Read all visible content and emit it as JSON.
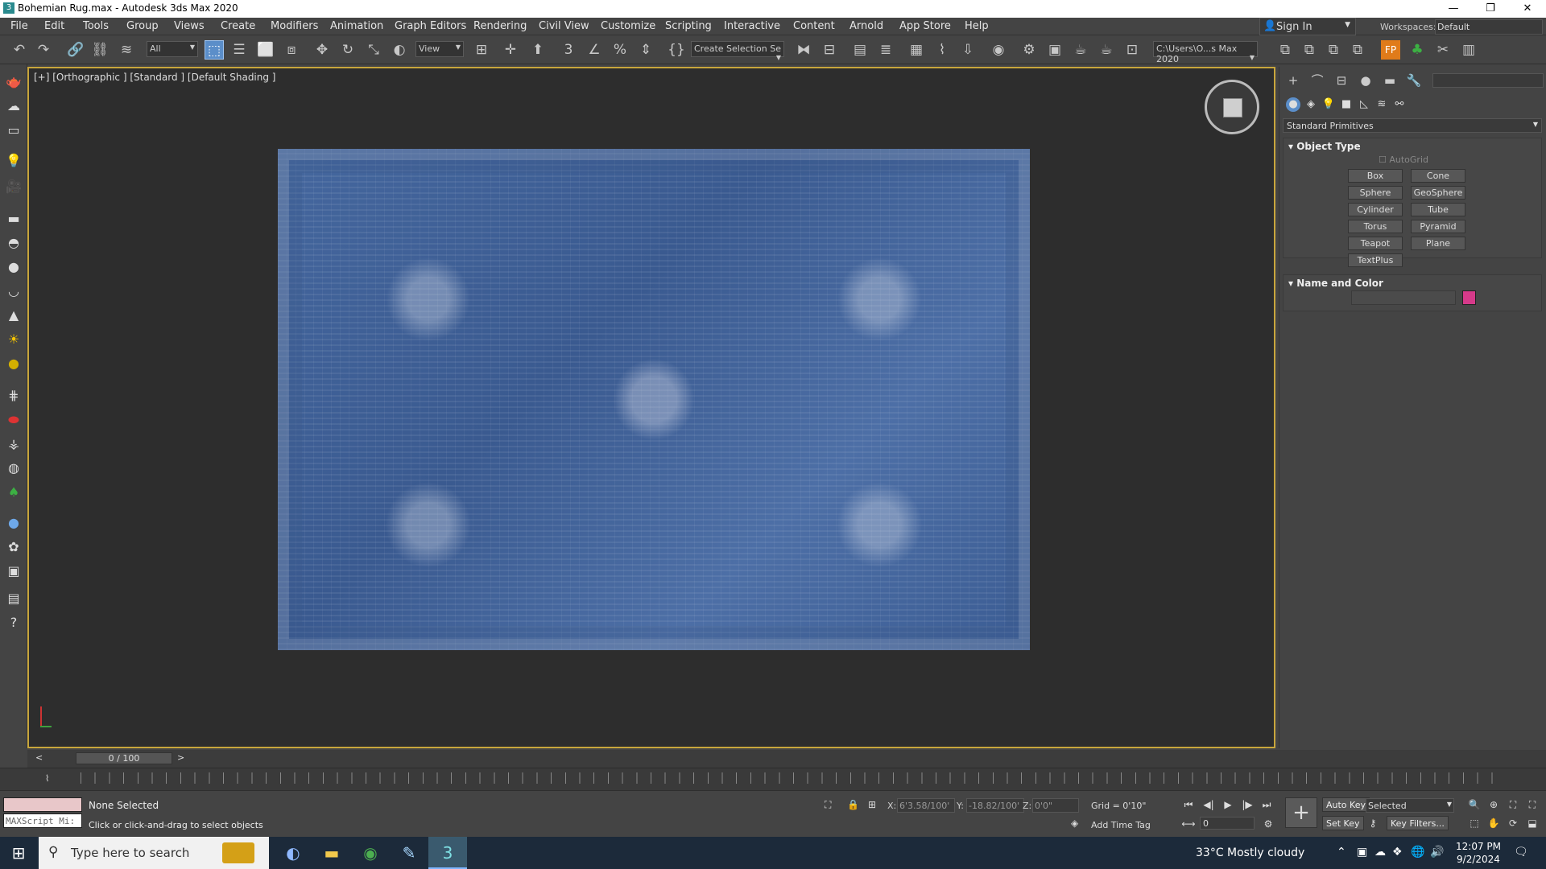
{
  "window": {
    "title": "Bohemian Rug.max - Autodesk 3ds Max 2020",
    "minimize": "—",
    "maximize": "❐",
    "close": "✕"
  },
  "menu": [
    "File",
    "Edit",
    "Tools",
    "Group",
    "Views",
    "Create",
    "Modifiers",
    "Animation",
    "Graph Editors",
    "Rendering",
    "Civil View",
    "Customize",
    "Scripting",
    "Interactive",
    "Content",
    "Arnold",
    "App Store",
    "Help"
  ],
  "signin": {
    "label": "Sign In"
  },
  "workspaces": {
    "label": "Workspaces:",
    "value": "Default"
  },
  "toolbar": {
    "selection_filter": "All",
    "ref_coord": "View",
    "named_selection": "Create Selection Se",
    "project_path": "C:\\Users\\O...s Max 2020"
  },
  "viewport": {
    "label": "[+] [Orthographic ] [Standard ] [Default Shading ]"
  },
  "command_panel": {
    "category": "Standard Primitives",
    "object_type": {
      "title": "Object Type",
      "autogrid": "AutoGrid",
      "buttons": [
        "Box",
        "Cone",
        "Sphere",
        "GeoSphere",
        "Cylinder",
        "Tube",
        "Torus",
        "Pyramid",
        "Teapot",
        "Plane",
        "TextPlus"
      ]
    },
    "name_color": {
      "title": "Name and Color",
      "swatch_color": "#d63a8a"
    }
  },
  "timeslider": {
    "frame": "0 / 100",
    "prev": "<",
    "next": ">"
  },
  "status": {
    "selection": "None Selected",
    "prompt": "Click or click-and-drag to select objects",
    "listener": "MAXScript Mi:",
    "x_label": "X:",
    "x_value": "6'3.58/100'",
    "y_label": "Y:",
    "y_value": "-18.82/100'",
    "z_label": "Z:",
    "z_value": "0'0\"",
    "grid": "Grid = 0'10\"",
    "add_time_tag": "Add Time Tag",
    "auto_key": "Auto Key",
    "set_key": "Set Key",
    "key_mode": "Selected",
    "key_filters": "Key Filters...",
    "frame_input": "0"
  },
  "taskbar": {
    "search_placeholder": "Type here to search",
    "weather": "33°C  Mostly cloudy",
    "time": "12:07 PM",
    "date": "9/2/2024"
  }
}
